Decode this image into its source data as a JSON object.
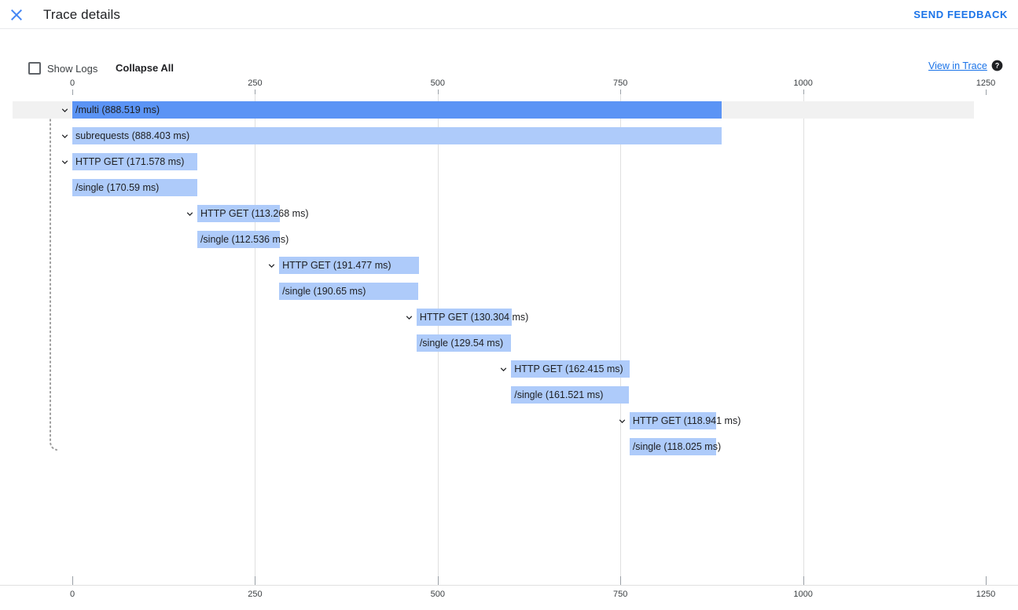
{
  "header": {
    "title": "Trace details",
    "close_icon": "close-icon",
    "send_feedback_label": "SEND FEEDBACK"
  },
  "toolbar": {
    "show_logs_label": "Show Logs",
    "show_logs_checked": false,
    "collapse_all_label": "Collapse All",
    "view_in_trace_label": "View in Trace",
    "help_icon": "help-icon"
  },
  "colors": {
    "accent": "#1a73e8",
    "root_bar": "#5b94f5",
    "child_bar": "#aecbfa",
    "row_highlight": "#f1f1f1",
    "gridline": "#e0e0e0"
  },
  "chart_data": {
    "type": "bar",
    "title": "Trace details",
    "xlabel": "",
    "ylabel": "",
    "orientation": "horizontal",
    "grid": true,
    "legend": "none",
    "xlim": [
      0,
      1250
    ],
    "x_unit": "ms",
    "x_ticks": [
      0,
      250,
      500,
      750,
      1000,
      1250
    ],
    "x_tick_labels": [
      "0",
      "250",
      "500",
      "750",
      "1000",
      "1250"
    ],
    "axis_top": true,
    "axis_bottom": true,
    "spans": [
      {
        "label": "/multi (888.519 ms)",
        "name": "/multi",
        "duration_ms": 888.519,
        "start_ms": 0,
        "depth": 0,
        "expanded": true,
        "selected": true,
        "has_children": true
      },
      {
        "label": "subrequests (888.403 ms)",
        "name": "subrequests",
        "duration_ms": 888.403,
        "start_ms": 0,
        "depth": 1,
        "expanded": true,
        "selected": false,
        "has_children": true
      },
      {
        "label": "HTTP GET (171.578 ms)",
        "name": "HTTP GET",
        "duration_ms": 171.578,
        "start_ms": 0,
        "depth": 2,
        "expanded": true,
        "selected": false,
        "has_children": true
      },
      {
        "label": "/single (170.59 ms)",
        "name": "/single",
        "duration_ms": 170.59,
        "start_ms": 0,
        "depth": 3,
        "expanded": false,
        "selected": false,
        "has_children": false
      },
      {
        "label": "HTTP GET (113.268 ms)",
        "name": "HTTP GET",
        "duration_ms": 113.268,
        "start_ms": 171.0,
        "depth": 2,
        "expanded": true,
        "selected": false,
        "has_children": true
      },
      {
        "label": "/single (112.536 ms)",
        "name": "/single",
        "duration_ms": 112.536,
        "start_ms": 171.0,
        "depth": 3,
        "expanded": false,
        "selected": false,
        "has_children": false
      },
      {
        "label": "HTTP GET (191.477 ms)",
        "name": "HTTP GET",
        "duration_ms": 191.477,
        "start_ms": 283.0,
        "depth": 2,
        "expanded": true,
        "selected": false,
        "has_children": true
      },
      {
        "label": "/single (190.65 ms)",
        "name": "/single",
        "duration_ms": 190.65,
        "start_ms": 283.0,
        "depth": 3,
        "expanded": false,
        "selected": false,
        "has_children": false
      },
      {
        "label": "HTTP GET (130.304 ms)",
        "name": "HTTP GET",
        "duration_ms": 130.304,
        "start_ms": 471.0,
        "depth": 2,
        "expanded": true,
        "selected": false,
        "has_children": true
      },
      {
        "label": "/single (129.54 ms)",
        "name": "/single",
        "duration_ms": 129.54,
        "start_ms": 471.0,
        "depth": 3,
        "expanded": false,
        "selected": false,
        "has_children": false
      },
      {
        "label": "HTTP GET (162.415 ms)",
        "name": "HTTP GET",
        "duration_ms": 162.415,
        "start_ms": 600.5,
        "depth": 2,
        "expanded": true,
        "selected": false,
        "has_children": true
      },
      {
        "label": "/single (161.521 ms)",
        "name": "/single",
        "duration_ms": 161.521,
        "start_ms": 600.5,
        "depth": 3,
        "expanded": false,
        "selected": false,
        "has_children": false
      },
      {
        "label": "HTTP GET (118.941 ms)",
        "name": "HTTP GET",
        "duration_ms": 118.941,
        "start_ms": 762.5,
        "depth": 2,
        "expanded": true,
        "selected": false,
        "has_children": true
      },
      {
        "label": "/single (118.025 ms)",
        "name": "/single",
        "duration_ms": 118.025,
        "start_ms": 762.5,
        "depth": 3,
        "expanded": false,
        "selected": false,
        "has_children": false
      }
    ]
  }
}
